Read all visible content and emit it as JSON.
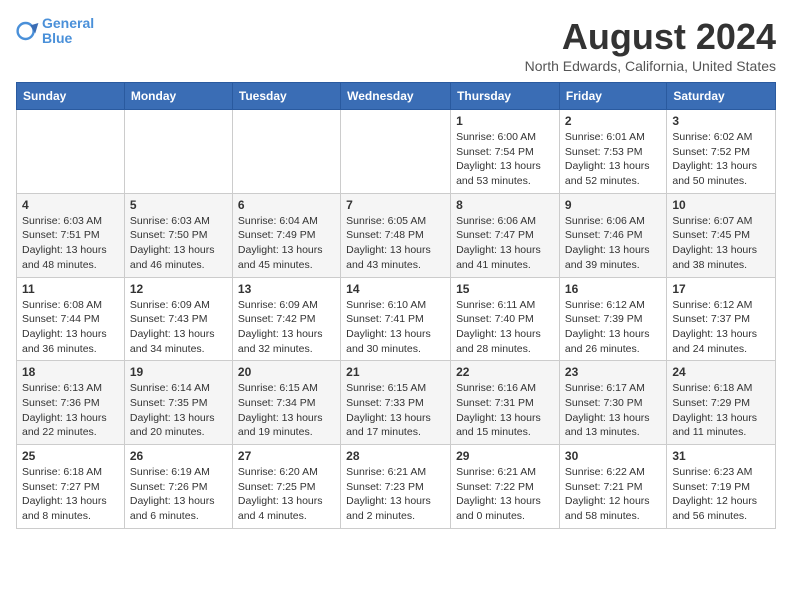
{
  "header": {
    "logo": {
      "line1": "General",
      "line2": "Blue"
    },
    "title": "August 2024",
    "location": "North Edwards, California, United States"
  },
  "calendar": {
    "days_of_week": [
      "Sunday",
      "Monday",
      "Tuesday",
      "Wednesday",
      "Thursday",
      "Friday",
      "Saturday"
    ],
    "weeks": [
      [
        {
          "day": "",
          "info": ""
        },
        {
          "day": "",
          "info": ""
        },
        {
          "day": "",
          "info": ""
        },
        {
          "day": "",
          "info": ""
        },
        {
          "day": "1",
          "info": "Sunrise: 6:00 AM\nSunset: 7:54 PM\nDaylight: 13 hours\nand 53 minutes."
        },
        {
          "day": "2",
          "info": "Sunrise: 6:01 AM\nSunset: 7:53 PM\nDaylight: 13 hours\nand 52 minutes."
        },
        {
          "day": "3",
          "info": "Sunrise: 6:02 AM\nSunset: 7:52 PM\nDaylight: 13 hours\nand 50 minutes."
        }
      ],
      [
        {
          "day": "4",
          "info": "Sunrise: 6:03 AM\nSunset: 7:51 PM\nDaylight: 13 hours\nand 48 minutes."
        },
        {
          "day": "5",
          "info": "Sunrise: 6:03 AM\nSunset: 7:50 PM\nDaylight: 13 hours\nand 46 minutes."
        },
        {
          "day": "6",
          "info": "Sunrise: 6:04 AM\nSunset: 7:49 PM\nDaylight: 13 hours\nand 45 minutes."
        },
        {
          "day": "7",
          "info": "Sunrise: 6:05 AM\nSunset: 7:48 PM\nDaylight: 13 hours\nand 43 minutes."
        },
        {
          "day": "8",
          "info": "Sunrise: 6:06 AM\nSunset: 7:47 PM\nDaylight: 13 hours\nand 41 minutes."
        },
        {
          "day": "9",
          "info": "Sunrise: 6:06 AM\nSunset: 7:46 PM\nDaylight: 13 hours\nand 39 minutes."
        },
        {
          "day": "10",
          "info": "Sunrise: 6:07 AM\nSunset: 7:45 PM\nDaylight: 13 hours\nand 38 minutes."
        }
      ],
      [
        {
          "day": "11",
          "info": "Sunrise: 6:08 AM\nSunset: 7:44 PM\nDaylight: 13 hours\nand 36 minutes."
        },
        {
          "day": "12",
          "info": "Sunrise: 6:09 AM\nSunset: 7:43 PM\nDaylight: 13 hours\nand 34 minutes."
        },
        {
          "day": "13",
          "info": "Sunrise: 6:09 AM\nSunset: 7:42 PM\nDaylight: 13 hours\nand 32 minutes."
        },
        {
          "day": "14",
          "info": "Sunrise: 6:10 AM\nSunset: 7:41 PM\nDaylight: 13 hours\nand 30 minutes."
        },
        {
          "day": "15",
          "info": "Sunrise: 6:11 AM\nSunset: 7:40 PM\nDaylight: 13 hours\nand 28 minutes."
        },
        {
          "day": "16",
          "info": "Sunrise: 6:12 AM\nSunset: 7:39 PM\nDaylight: 13 hours\nand 26 minutes."
        },
        {
          "day": "17",
          "info": "Sunrise: 6:12 AM\nSunset: 7:37 PM\nDaylight: 13 hours\nand 24 minutes."
        }
      ],
      [
        {
          "day": "18",
          "info": "Sunrise: 6:13 AM\nSunset: 7:36 PM\nDaylight: 13 hours\nand 22 minutes."
        },
        {
          "day": "19",
          "info": "Sunrise: 6:14 AM\nSunset: 7:35 PM\nDaylight: 13 hours\nand 20 minutes."
        },
        {
          "day": "20",
          "info": "Sunrise: 6:15 AM\nSunset: 7:34 PM\nDaylight: 13 hours\nand 19 minutes."
        },
        {
          "day": "21",
          "info": "Sunrise: 6:15 AM\nSunset: 7:33 PM\nDaylight: 13 hours\nand 17 minutes."
        },
        {
          "day": "22",
          "info": "Sunrise: 6:16 AM\nSunset: 7:31 PM\nDaylight: 13 hours\nand 15 minutes."
        },
        {
          "day": "23",
          "info": "Sunrise: 6:17 AM\nSunset: 7:30 PM\nDaylight: 13 hours\nand 13 minutes."
        },
        {
          "day": "24",
          "info": "Sunrise: 6:18 AM\nSunset: 7:29 PM\nDaylight: 13 hours\nand 11 minutes."
        }
      ],
      [
        {
          "day": "25",
          "info": "Sunrise: 6:18 AM\nSunset: 7:27 PM\nDaylight: 13 hours\nand 8 minutes."
        },
        {
          "day": "26",
          "info": "Sunrise: 6:19 AM\nSunset: 7:26 PM\nDaylight: 13 hours\nand 6 minutes."
        },
        {
          "day": "27",
          "info": "Sunrise: 6:20 AM\nSunset: 7:25 PM\nDaylight: 13 hours\nand 4 minutes."
        },
        {
          "day": "28",
          "info": "Sunrise: 6:21 AM\nSunset: 7:23 PM\nDaylight: 13 hours\nand 2 minutes."
        },
        {
          "day": "29",
          "info": "Sunrise: 6:21 AM\nSunset: 7:22 PM\nDaylight: 13 hours\nand 0 minutes."
        },
        {
          "day": "30",
          "info": "Sunrise: 6:22 AM\nSunset: 7:21 PM\nDaylight: 12 hours\nand 58 minutes."
        },
        {
          "day": "31",
          "info": "Sunrise: 6:23 AM\nSunset: 7:19 PM\nDaylight: 12 hours\nand 56 minutes."
        }
      ]
    ]
  }
}
